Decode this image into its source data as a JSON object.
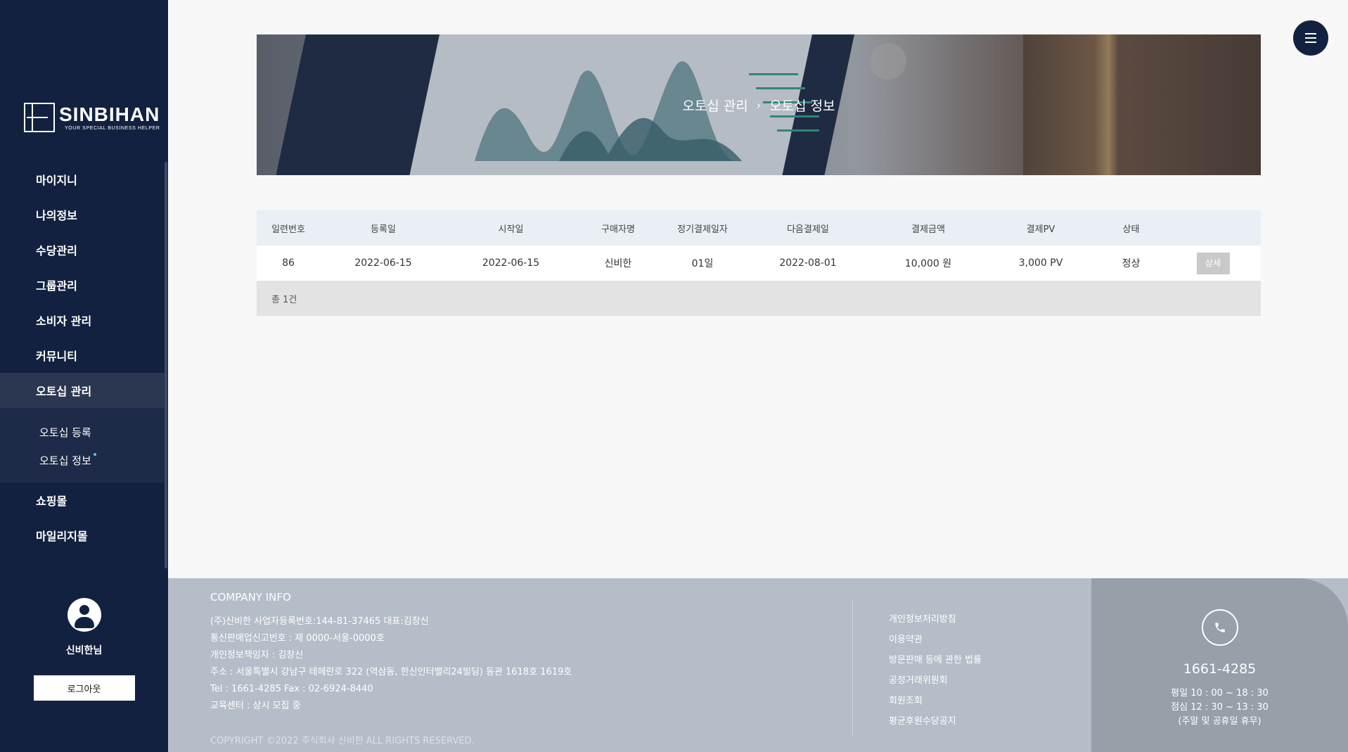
{
  "brand": {
    "name": "SINBIHAN",
    "tagline": "YOUR SPECIAL BUSINESS HELPER"
  },
  "sidebar": {
    "items": [
      {
        "label": "마이지니"
      },
      {
        "label": "나의정보"
      },
      {
        "label": "수당관리"
      },
      {
        "label": "그룹관리"
      },
      {
        "label": "소비자 관리"
      },
      {
        "label": "커뮤니티"
      },
      {
        "label": "오토십 관리",
        "active": true
      },
      {
        "label": "쇼핑몰"
      },
      {
        "label": "마일리지몰"
      }
    ],
    "submenu": [
      {
        "label": "오토십 등록"
      },
      {
        "label": "오토십 정보",
        "active": true
      }
    ],
    "user_name": "신비한님",
    "logout_label": "로그아웃"
  },
  "banner": {
    "breadcrumb_parent": "오토십 관리",
    "breadcrumb_separator": "›",
    "breadcrumb_current": "오토십 정보"
  },
  "table": {
    "headers": [
      "일련번호",
      "등록일",
      "시작일",
      "구매자명",
      "정기결제일자",
      "다음결제일",
      "결제금액",
      "결제PV",
      "상태",
      ""
    ],
    "rows": [
      {
        "serial": "86",
        "registered": "2022-06-15",
        "start": "2022-06-15",
        "buyer": "신비한",
        "billing_day": "01일",
        "next_payment": "2022-08-01",
        "amount": "10,000 원",
        "pv": "3,000 PV",
        "status": "정상",
        "detail_label": "상세"
      }
    ],
    "total": "총 1건"
  },
  "footer": {
    "title": "COMPANY INFO",
    "lines": [
      "(주)신비한    사업자등록번호:144-81-37465    대표:김창신",
      "통신판매업신고번호 : 제 0000-서울-0000호",
      "개인정보책임자 : 김창신",
      "주소 : 서울특별시 강남구 테헤란로 322 (역삼동, 한신인터밸리24빌딩) 동관 1618호 1619호",
      "Tel : 1661-4285    Fax : 02-6924-8440",
      "교육센터 : 상시 모집 중"
    ],
    "copyright": "COPYRIGHT ©2022 주식회사 신비한 ALL RIGHTS RESERVED.",
    "links": [
      "개인정보처리방침",
      "이용약관",
      "방문판매 등에 관한 법률",
      "공정거래위원회",
      "회원조회",
      "평균후원수당공지"
    ],
    "contact": {
      "phone": "1661-4285",
      "hours": [
        "평일 10 : 00 ~ 18 : 30",
        "점심 12 : 30 ~ 13 : 30",
        "(주말 및 공휴일 휴무)"
      ]
    }
  },
  "icons": {
    "menu": "hamburger-icon",
    "phone": "phone-icon",
    "user": "user-icon"
  },
  "colors": {
    "sidebar_bg": "#12213f",
    "footer_bg": "#b5bdc8",
    "contact_bg": "#979fa9",
    "table_header_bg": "#e9eff4"
  }
}
